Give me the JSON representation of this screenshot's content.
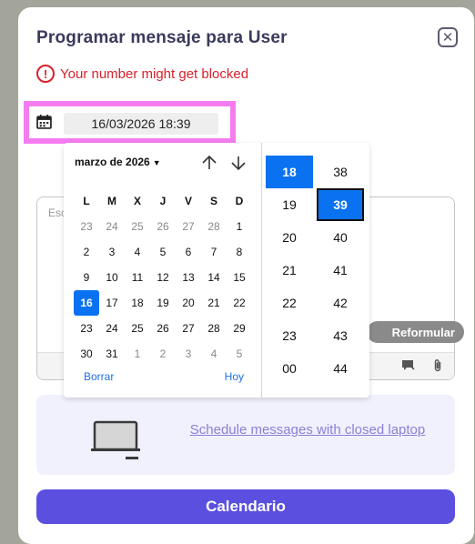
{
  "modal": {
    "title": "Programar mensaje para User",
    "close_icon": "close-icon",
    "warning": "Your number might get blocked",
    "date_value": "16/03/2026 18:39",
    "textarea_placeholder": "Esc",
    "reformular_label": "Reformular",
    "promo_link": "Schedule messages with closed laptop",
    "calendar_button": "Calendario"
  },
  "picker": {
    "month_label": "marzo de 2026",
    "weekdays": [
      "L",
      "M",
      "X",
      "J",
      "V",
      "S",
      "D"
    ],
    "weeks": [
      [
        {
          "d": "23",
          "m": true
        },
        {
          "d": "24",
          "m": true
        },
        {
          "d": "25",
          "m": true
        },
        {
          "d": "26",
          "m": true
        },
        {
          "d": "27",
          "m": true
        },
        {
          "d": "28",
          "m": true
        },
        {
          "d": "1",
          "m": false
        }
      ],
      [
        {
          "d": "2"
        },
        {
          "d": "3"
        },
        {
          "d": "4"
        },
        {
          "d": "5"
        },
        {
          "d": "6"
        },
        {
          "d": "7"
        },
        {
          "d": "8"
        }
      ],
      [
        {
          "d": "9"
        },
        {
          "d": "10"
        },
        {
          "d": "11"
        },
        {
          "d": "12"
        },
        {
          "d": "13"
        },
        {
          "d": "14"
        },
        {
          "d": "15"
        }
      ],
      [
        {
          "d": "16",
          "s": true
        },
        {
          "d": "17"
        },
        {
          "d": "18"
        },
        {
          "d": "19"
        },
        {
          "d": "20"
        },
        {
          "d": "21"
        },
        {
          "d": "22"
        }
      ],
      [
        {
          "d": "23"
        },
        {
          "d": "24"
        },
        {
          "d": "25"
        },
        {
          "d": "26"
        },
        {
          "d": "27"
        },
        {
          "d": "28"
        },
        {
          "d": "29"
        }
      ],
      [
        {
          "d": "30"
        },
        {
          "d": "31"
        },
        {
          "d": "1",
          "m": true
        },
        {
          "d": "2",
          "m": true
        },
        {
          "d": "3",
          "m": true
        },
        {
          "d": "4",
          "m": true
        },
        {
          "d": "5",
          "m": true
        }
      ]
    ],
    "clear_label": "Borrar",
    "today_label": "Hoy",
    "hours": [
      "18",
      "19",
      "20",
      "21",
      "22",
      "23",
      "00"
    ],
    "selected_hour": "18",
    "minutes": [
      "38",
      "39",
      "40",
      "41",
      "42",
      "43",
      "44"
    ],
    "selected_minute": "39"
  },
  "colors": {
    "accent": "#0a72f0",
    "primary_button": "#5a4fdf",
    "warning": "#d9212b",
    "highlight_border": "#f57cf0"
  }
}
